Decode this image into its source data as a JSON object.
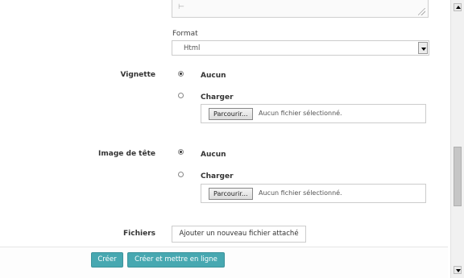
{
  "format": {
    "label": "Format",
    "selected": "Html"
  },
  "vignette": {
    "label": "Vignette",
    "options": [
      "Aucun",
      "Charger"
    ],
    "file_button": "Parcourir...",
    "file_status": "Aucun fichier sélectionné."
  },
  "header_image": {
    "label": "Image de tête",
    "options": [
      "Aucun",
      "Charger"
    ],
    "file_button": "Parcourir...",
    "file_status": "Aucun fichier sélectionné."
  },
  "files": {
    "label": "Fichiers",
    "add_button": "Ajouter un nouveau fichier attaché"
  },
  "actions": {
    "create": "Créer",
    "create_publish": "Créer et mettre en ligne"
  },
  "colors": {
    "primary": "#47a8b1"
  }
}
